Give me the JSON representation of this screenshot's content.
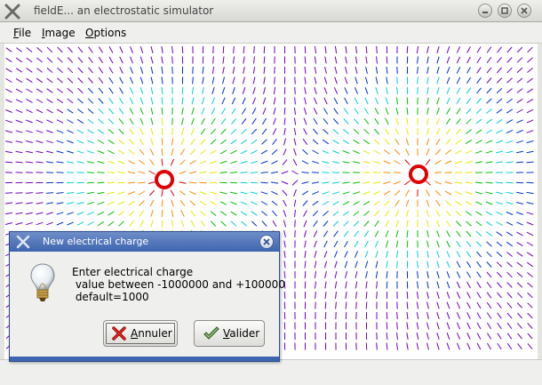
{
  "window": {
    "title": "fieldE... an electrostatic simulator",
    "icon": "x-app-icon",
    "controls": [
      "minimize-icon",
      "maximize-icon",
      "close-icon"
    ]
  },
  "menubar": {
    "items": [
      {
        "label": "File",
        "mnemonic": "F",
        "rest": "ile"
      },
      {
        "label": "Image",
        "mnemonic": "I",
        "rest": "mage"
      },
      {
        "label": "Options",
        "mnemonic": "O",
        "rest": "ptions"
      }
    ]
  },
  "field": {
    "charges": [
      {
        "id": "charge-1",
        "color": "#e00000"
      },
      {
        "id": "charge-2",
        "color": "#e00000"
      }
    ],
    "arrow_palette": [
      "#e00000",
      "#ff8800",
      "#e8e800",
      "#00c000",
      "#00d0d0",
      "#0030d0",
      "#7000c0"
    ]
  },
  "dialog": {
    "title": "New electrical charge",
    "icon": "x-app-icon",
    "message_icon": "lightbulb-icon",
    "message": "Enter electrical charge\n value between -1000000 and +100000\n default=1000",
    "buttons": {
      "cancel": {
        "label": "Annuler",
        "mnemonic": "A",
        "rest": "nnuler",
        "icon": "red-x-icon"
      },
      "ok": {
        "label": "Valider",
        "mnemonic": "V",
        "rest": "alider",
        "icon": "green-check-icon"
      }
    }
  }
}
